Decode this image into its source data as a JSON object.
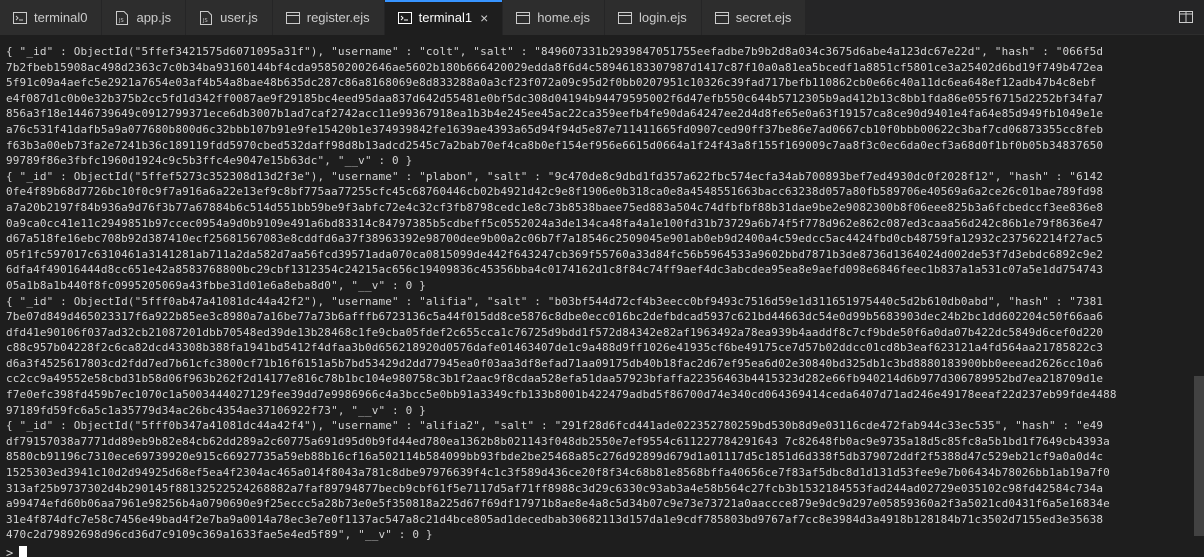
{
  "tabs": [
    {
      "label": "terminal0",
      "icon": "terminal-icon",
      "active": false
    },
    {
      "label": "app.js",
      "icon": "js-file-icon",
      "active": false
    },
    {
      "label": "user.js",
      "icon": "js-file-icon",
      "active": false
    },
    {
      "label": "register.ejs",
      "icon": "ejs-file-icon",
      "active": false
    },
    {
      "label": "terminal1",
      "icon": "terminal-icon",
      "active": true,
      "close": "×"
    },
    {
      "label": "home.ejs",
      "icon": "ejs-file-icon",
      "active": false
    },
    {
      "label": "login.ejs",
      "icon": "ejs-file-icon",
      "active": false
    },
    {
      "label": "secret.ejs",
      "icon": "ejs-file-icon",
      "active": false
    }
  ],
  "terminal": {
    "lines": [
      "{ \"_id\" : ObjectId(\"5ffef3421575d6071095a31f\"), \"username\" : \"colt\", \"salt\" : \"849607331b2939847051755eefadbe7b9b2d8a034c3675d6abe4a123dc67e22d\", \"hash\" : \"066f5d",
      "7b2fbeb15908ac498d2363c7c0b34ba93160144bf4cda958502002646ae5602b180b666420029edda8f6d4c58946183307987d1417c87f10a0a81ea5bcedf1a8851cf5801ce3a25402d6bd19f749b472ea",
      "5f91c09a4aefc5e2921a7654e03af4b54a8bae48b635dc287c86a8168069e8d833288a0a3cf23f072a09c95d2f0bb0207951c10326c39fad717befb110862cb0e66c40a11dc6ea648ef12adb47b4c8ebf",
      "e4f087d1c0b0e32b375b2cc5fd1d342ff0087ae9f29185bc4eed95daa837d642d55481e0bf5dc308d04194b94479595002f6d47efb550c644b5712305b9ad412b13c8bb1fda86e055f6715d2252bf34fa7",
      "856a3f18e1446739649c0912799371ece6db3007b1ad7caf2742acc11e99367918ea1b3b4e245ee45ac22ca359eefb4fe90da64247ee2d4d8fe65e0a63f19157ca8ce90d9401e4fa64e85d949fb1049e1e",
      "a76c531f41dafb5a9a077680b800d6c32bbb107b91e9fe15420b1e374939842fe1639ae4393a65d94f94d5e87e711411665fd0907ced90ff37be86e7ad0667cb10f0bbb00622c3baf7cd06873355cc8feb",
      "f63b3a00eb73fa2e7241b36c189119fdd5970cbed532daff98d8b13adcd2545c7a2bab70ef4ca8b0ef154ef956e6615d0664a1f24f43a8f155f169009c7aa8f3c0ec6da0ecf3a68d0f1bf0b05b34837650",
      "99789f86e3fbfc1960d1924c9c5b3ffc4e9047e15b63dc\", \"__v\" : 0 }",
      "{ \"_id\" : ObjectId(\"5ffef5273c352308d13d2f3e\"), \"username\" : \"plabon\", \"salt\" : \"9c470de8c9dbd1fd357a622fbc574ecfa34ab700893bef7ed4930dc0f2028f12\", \"hash\" : \"6142",
      "0fe4f89b68d7726bc10f0c9f7a916a6a22e13ef9c8bf775aa77255cfc45c68760446cb02b4921d42c9e8f1906e0b318ca0e8a4548551663bacc63238d057a80fb589706e40569a6a2ce26c01bae789fd98",
      "a7a20b2197f84b936a9d76f3b77a67884b6c514d551bb59be9f3abfc72e4c32cf3fb8798cedc1e8c73b8538baee75ed883a504c74dfbfbf88b31dae9be2e9082300b8f06eee825b3a6fcbedccf3ee836e8",
      "0a9ca0cc41e11c2949851b97ccec0954a9d0b9109e491a6bd83314c84797385b5cdbeff5c0552024a3de134ca48fa4a1e100fd31b73729a6b74f5f778d962e862c087ed3caaa56d242c86b1e79f8636e47",
      "d67a518fe16ebc708b92d387410ecf25681567083e8cddfd6a37f38963392e98700dee9b00a2c06b7f7a18546c2509045e901ab0eb9d2400a4c59edcc5ac4424fbd0cb48759fa12932c237562214f27ac5",
      "05f1fc597017c6310461a3141281ab711a2da582d7aa56fcd39571ada070ca0815099de442f643247cb369f55760a33d84fc56b5964533a9602bbd7871b3de8736d1364024d002de53f7d3ebdc6892c9e2",
      "6dfa4f49016444d8cc651e42a8583768800bc29cbf1312354c24215ac656c19409836c45356bba4c0174162d1c8f84c74ff9aef4dc3abcdea95ea8e9aefd098e6846feec1b837a1a531c07a5e1dd754743",
      "05a1b8a1b440f8fc0995205069a43fbbe31d01e6a8eba8d0\", \"__v\" : 0 }",
      "{ \"_id\" : ObjectId(\"5fff0ab47a41081dc44a42f2\"), \"username\" : \"alifia\", \"salt\" : \"b03bf544d72cf4b3eecc0bf9493c7516d59e1d311651975440c5d2b610db0abd\", \"hash\" : \"7381",
      "7be07d849d465023317f6a922b85ee3c8980a7a16be77a73b6afffb6723136c5a44f015dd8ce5876c8dbe0ecc016bc2defbdcad5937c621bd44663dc54e0d99b5683903dec24b2bc1dd602204c50f66aa6",
      "dfd41e90106f037ad32cb21087201dbb70548ed39de13b28468c1fe9cba05fdef2c655cca1c76725d9bdd1f572d84342e82af1963492a78ea939b4aaddf8c7cf9bde50f6a0da07b422dc5849d6cef0d220",
      "c88c957b04228f2c6ca82dcd43308b388fa1941bd5412f4dfaa3b0d656218920d0576dafe01463407de1c9a488d9ff1026e41935cf6be49175ce7d57b02ddcc01cd8b3eaf623121a4fd564aa21785822c3",
      "d6a3f4525617803cd2fdd7ed7b61cfc3800cf71b16f6151a5b7bd53429d2dd77945ea0f03aa3df8efad71aa09175db40b18fac2d67ef95ea6d02e30840bd325db1c3bd8880183900bb0eeead2626cc10a6",
      "cc2cc9a49552e58cbd31b58d06f963b262f2d14177e816c78b1bc104e980758c3b1f2aac9f8cdaa528efa51daa57923bfaffa22356463b4415323d282e66fb940214d6b977d306789952bd7ea218709d1e",
      "f7e0efc398fd459b7ec1070c1a5003444027129fee39dd7e9986966c4a3bcc5e0bb91a3349cfb133b8001b422479adbd5f86700d74e340cd064369414ceda6407d71ad246e49178eeaf22d237eb99fde4488",
      "97189fd59fc6a5c1a35779d34ac26bc4354ae37106922f73\", \"__v\" : 0 }",
      "{ \"_id\" : ObjectId(\"5fff0b347a41081dc44a42f4\"), \"username\" : \"alifia2\", \"salt\" : \"291f28d6fcd441ade022352780259bd530b8d9e03116cde472fab944c33ec535\", \"hash\" : \"e49",
      "df79157038a7771dd89eb9b82e84cb62dd289a2c60775a691d95d0b9fd44ed780ea1362b8b021143f048db2550e7ef9554c611227784291643 7c82648fb0ac9e9735a18d5c85fc8a5b1bd1f7649cb4393a",
      "8580cb91196c7310ece69739920e915c66927735a59eb88b16cf16a502114b584099bb93fbde2be25468a85c276d92899d679d1a01117d5c1851d6d338f5db379072ddf2f5388d47c529eb21cf9a0a0d4c",
      "1525303ed3941c10d2d94925d68ef5ea4f2304ac465a014f8043a781c8dbe97976639f4c1c3f589d436ce20f8f34c68b81e8568bffa40656ce7f83af5dbc8d1d131d53fee9e7b06434b78026bb1ab19a7f0",
      "313af25b9737302d4b290145f88132522524268882a7faf89794877becb9cbf61f5e7117d5af71ff8988c3d29c6330c93ab3a4e58b564c27fcb3b1532184553fad244ad02729e035102c98fd42584c734a",
      "a99474efd60b06aa7961e98256b4a0790690e9f25eccc5a28b73e0e5f350818a225d67f69df17971b8ae8e4a8c5d34b07c9e73e73721a0aaccce879e9dc9d297e05859360a2f3a5021cd0431f6a5e16834e",
      "31e4f874dfc7e58c7456e49bad4f2e7ba9a0014a78ec3e7e0f1137ac547a8c21d4bce805ad1decedbab30682113d157da1e9cdf785803bd9767af7cc8e3984d3a4918b128184b71c3502d7155ed3e35638",
      "470c2d79892698d96cd36d7c9109c369a1633fae5e4ed5f89\", \"__v\" : 0 }"
    ],
    "prompt": ">"
  }
}
